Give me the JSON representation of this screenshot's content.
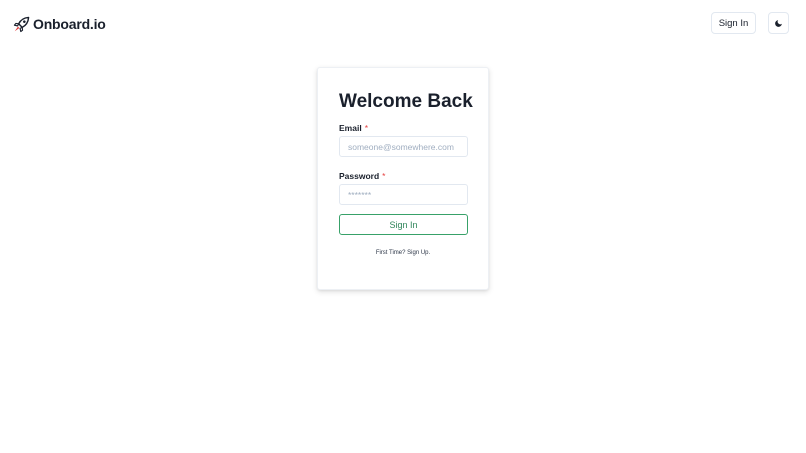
{
  "brand": {
    "name": "Onboard.io",
    "icon": "rocket-icon",
    "icon_color": "#1a202c",
    "accent_color": "#e53e3e"
  },
  "nav": {
    "signin_label": "Sign In",
    "theme_icon": "moon-icon"
  },
  "login": {
    "title": "Welcome Back",
    "email_label": "Email",
    "email_required": "*",
    "email_placeholder": "someone@somewhere.com",
    "email_value": "",
    "password_label": "Password",
    "password_required": "*",
    "password_placeholder": "*******",
    "password_value": "",
    "submit_label": "Sign In",
    "signup_prompt": "First Time?",
    "signup_link": "Sign Up."
  },
  "colors": {
    "button_border": "#38a169",
    "button_text": "#2f855a",
    "required_mark": "#e53e3e"
  }
}
